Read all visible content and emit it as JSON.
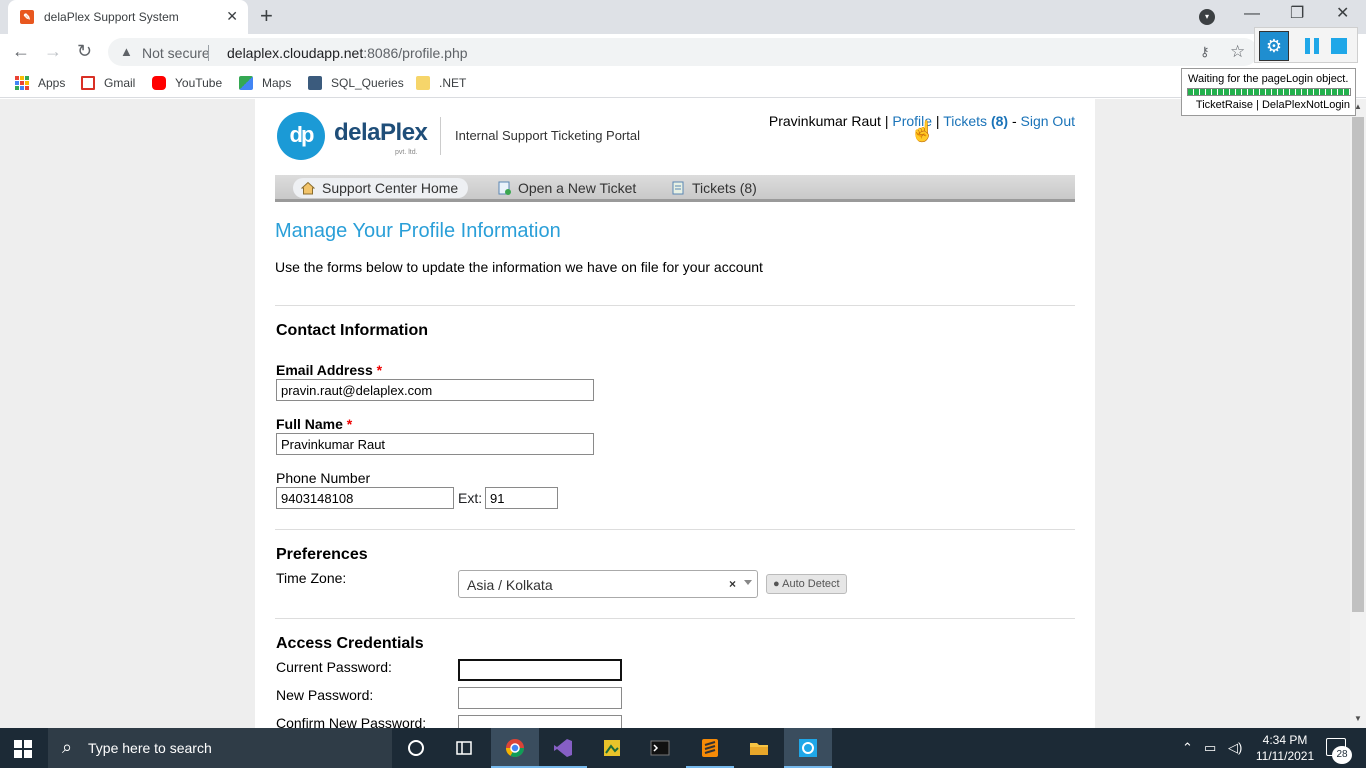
{
  "browser": {
    "tab_title": "delaPlex Support System",
    "tab_close": "✕",
    "new_tab": "+",
    "security": "Not secure",
    "url_host": "delaplex.cloudapp.net",
    "url_rest": ":8086/profile.php",
    "bookmarks": [
      "Apps",
      "Gmail",
      "YouTube",
      "Maps",
      "SQL_Queries",
      ".NET"
    ]
  },
  "header": {
    "logo_mark": "dp",
    "logo_text": "delaPlex",
    "logo_sub": "pvt. ltd.",
    "portal_title": "Internal Support Ticketing Portal",
    "user_name": "Pravinkumar Raut",
    "sep1": " | ",
    "profile_link": "Profile",
    "sep2": " | ",
    "tickets_link": "Tickets",
    "tickets_count": "(8)",
    "sep3": " - ",
    "signout_link": "Sign Out"
  },
  "nav": {
    "home": "Support Center Home",
    "new_ticket": "Open a New Ticket",
    "tickets": "Tickets (8)"
  },
  "page": {
    "heading": "Manage Your Profile Information",
    "intro": "Use the forms below to update the information we have on file for your account"
  },
  "contact": {
    "title": "Contact Information",
    "email_label": "Email Address",
    "email_value": "pravin.raut@delaplex.com",
    "name_label": "Full Name",
    "name_value": "Pravinkumar Raut",
    "phone_label": "Phone Number",
    "phone_value": "9403148108",
    "ext_label": "Ext:",
    "ext_value": "91",
    "required_mark": "*"
  },
  "preferences": {
    "title": "Preferences",
    "tz_label": "Time Zone:",
    "tz_value": "Asia / Kolkata",
    "tz_clear": "×",
    "auto_detect": "Auto Detect"
  },
  "credentials": {
    "title": "Access Credentials",
    "current_label": "Current Password:",
    "new_label": "New Password:",
    "confirm_label": "Confirm New Password:"
  },
  "extension": {
    "message": "Waiting for the pageLogin object.",
    "info": "TicketRaise | DelaPlexNotLogin"
  },
  "taskbar": {
    "search_placeholder": "Type here to search",
    "time": "4:34 PM",
    "date": "11/11/2021",
    "notifications": "28"
  }
}
